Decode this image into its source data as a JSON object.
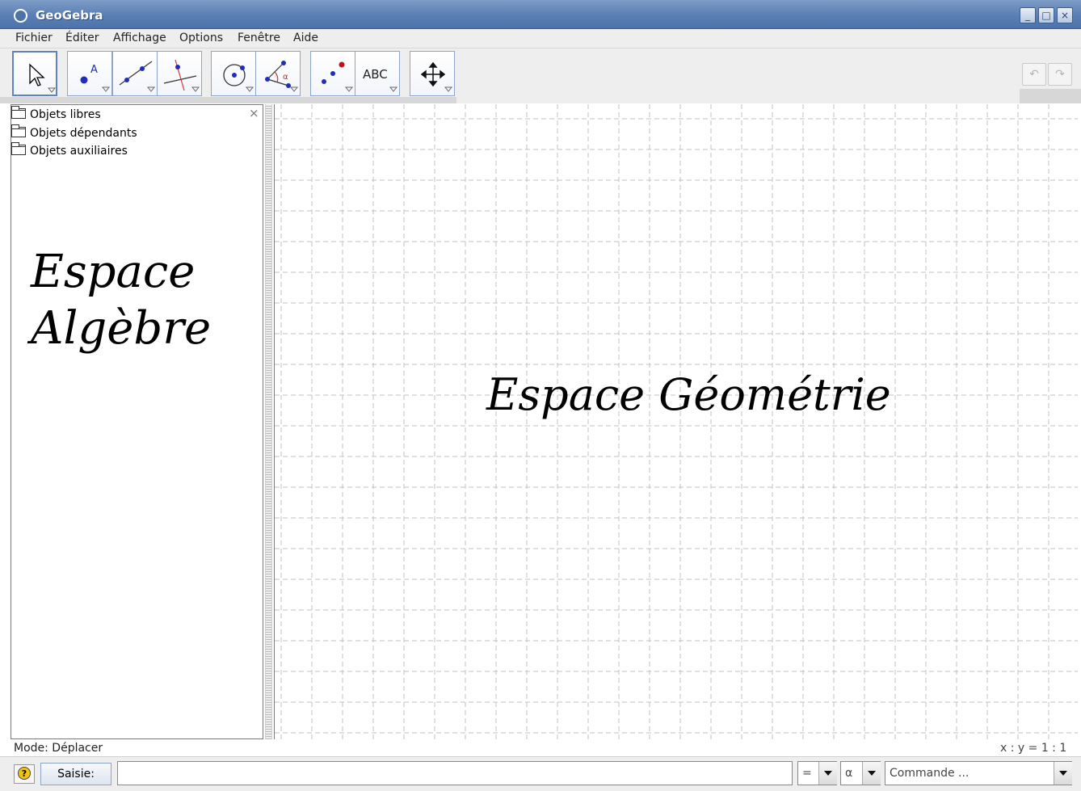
{
  "window": {
    "title": "GeoGebra",
    "controls": {
      "minimize": "_",
      "maximize": "□",
      "close": "×"
    }
  },
  "menu": [
    "Fichier",
    "Éditer",
    "Affichage",
    "Options",
    "Fenêtre",
    "Aide"
  ],
  "toolbar": {
    "tools": [
      {
        "id": "move",
        "icon": "pointer-arrow-icon"
      },
      {
        "id": "point",
        "icon": "point-icon",
        "label": "A"
      },
      {
        "id": "line",
        "icon": "line-through-points-icon"
      },
      {
        "id": "perpendicular",
        "icon": "perpendicular-line-icon"
      },
      {
        "id": "circle",
        "icon": "circle-icon"
      },
      {
        "id": "angle",
        "icon": "angle-icon",
        "label": "α"
      },
      {
        "id": "reflect",
        "icon": "reflect-point-icon"
      },
      {
        "id": "text",
        "icon": "text-icon",
        "label": "ABC"
      },
      {
        "id": "move-view",
        "icon": "move-graphics-icon"
      }
    ],
    "undo_label": "↶",
    "redo_label": "↷"
  },
  "algebra": {
    "folders": [
      "Objets libres",
      "Objets dépendants",
      "Objets auxiliaires"
    ],
    "close_label": "×",
    "overlay_line1": "Espace",
    "overlay_line2": "Algèbre"
  },
  "geometry": {
    "overlay": "Espace Géométrie"
  },
  "status": {
    "mode": "Mode: Déplacer",
    "scale": "x : y = 1 : 1"
  },
  "input": {
    "help": "?",
    "label": "Saisie:",
    "value": "",
    "combo1": "=",
    "combo2": "α",
    "command_placeholder": "Commande ..."
  }
}
